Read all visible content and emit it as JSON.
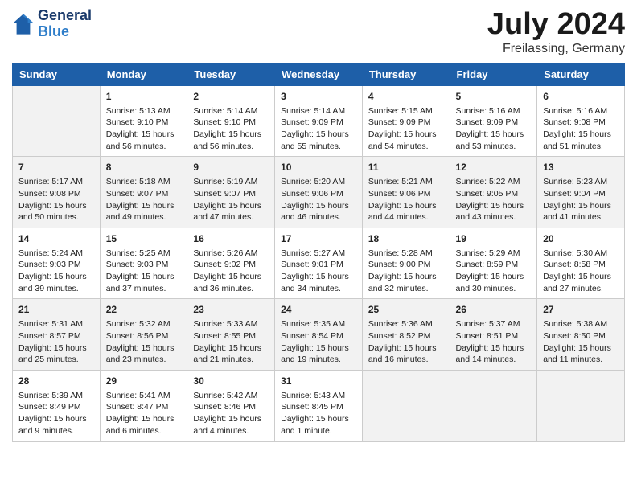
{
  "header": {
    "logo_line1": "General",
    "logo_line2": "Blue",
    "month": "July 2024",
    "location": "Freilassing, Germany"
  },
  "columns": [
    "Sunday",
    "Monday",
    "Tuesday",
    "Wednesday",
    "Thursday",
    "Friday",
    "Saturday"
  ],
  "weeks": [
    [
      {
        "day": "",
        "info": ""
      },
      {
        "day": "1",
        "info": "Sunrise: 5:13 AM\nSunset: 9:10 PM\nDaylight: 15 hours\nand 56 minutes."
      },
      {
        "day": "2",
        "info": "Sunrise: 5:14 AM\nSunset: 9:10 PM\nDaylight: 15 hours\nand 56 minutes."
      },
      {
        "day": "3",
        "info": "Sunrise: 5:14 AM\nSunset: 9:09 PM\nDaylight: 15 hours\nand 55 minutes."
      },
      {
        "day": "4",
        "info": "Sunrise: 5:15 AM\nSunset: 9:09 PM\nDaylight: 15 hours\nand 54 minutes."
      },
      {
        "day": "5",
        "info": "Sunrise: 5:16 AM\nSunset: 9:09 PM\nDaylight: 15 hours\nand 53 minutes."
      },
      {
        "day": "6",
        "info": "Sunrise: 5:16 AM\nSunset: 9:08 PM\nDaylight: 15 hours\nand 51 minutes."
      }
    ],
    [
      {
        "day": "7",
        "info": "Sunrise: 5:17 AM\nSunset: 9:08 PM\nDaylight: 15 hours\nand 50 minutes."
      },
      {
        "day": "8",
        "info": "Sunrise: 5:18 AM\nSunset: 9:07 PM\nDaylight: 15 hours\nand 49 minutes."
      },
      {
        "day": "9",
        "info": "Sunrise: 5:19 AM\nSunset: 9:07 PM\nDaylight: 15 hours\nand 47 minutes."
      },
      {
        "day": "10",
        "info": "Sunrise: 5:20 AM\nSunset: 9:06 PM\nDaylight: 15 hours\nand 46 minutes."
      },
      {
        "day": "11",
        "info": "Sunrise: 5:21 AM\nSunset: 9:06 PM\nDaylight: 15 hours\nand 44 minutes."
      },
      {
        "day": "12",
        "info": "Sunrise: 5:22 AM\nSunset: 9:05 PM\nDaylight: 15 hours\nand 43 minutes."
      },
      {
        "day": "13",
        "info": "Sunrise: 5:23 AM\nSunset: 9:04 PM\nDaylight: 15 hours\nand 41 minutes."
      }
    ],
    [
      {
        "day": "14",
        "info": "Sunrise: 5:24 AM\nSunset: 9:03 PM\nDaylight: 15 hours\nand 39 minutes."
      },
      {
        "day": "15",
        "info": "Sunrise: 5:25 AM\nSunset: 9:03 PM\nDaylight: 15 hours\nand 37 minutes."
      },
      {
        "day": "16",
        "info": "Sunrise: 5:26 AM\nSunset: 9:02 PM\nDaylight: 15 hours\nand 36 minutes."
      },
      {
        "day": "17",
        "info": "Sunrise: 5:27 AM\nSunset: 9:01 PM\nDaylight: 15 hours\nand 34 minutes."
      },
      {
        "day": "18",
        "info": "Sunrise: 5:28 AM\nSunset: 9:00 PM\nDaylight: 15 hours\nand 32 minutes."
      },
      {
        "day": "19",
        "info": "Sunrise: 5:29 AM\nSunset: 8:59 PM\nDaylight: 15 hours\nand 30 minutes."
      },
      {
        "day": "20",
        "info": "Sunrise: 5:30 AM\nSunset: 8:58 PM\nDaylight: 15 hours\nand 27 minutes."
      }
    ],
    [
      {
        "day": "21",
        "info": "Sunrise: 5:31 AM\nSunset: 8:57 PM\nDaylight: 15 hours\nand 25 minutes."
      },
      {
        "day": "22",
        "info": "Sunrise: 5:32 AM\nSunset: 8:56 PM\nDaylight: 15 hours\nand 23 minutes."
      },
      {
        "day": "23",
        "info": "Sunrise: 5:33 AM\nSunset: 8:55 PM\nDaylight: 15 hours\nand 21 minutes."
      },
      {
        "day": "24",
        "info": "Sunrise: 5:35 AM\nSunset: 8:54 PM\nDaylight: 15 hours\nand 19 minutes."
      },
      {
        "day": "25",
        "info": "Sunrise: 5:36 AM\nSunset: 8:52 PM\nDaylight: 15 hours\nand 16 minutes."
      },
      {
        "day": "26",
        "info": "Sunrise: 5:37 AM\nSunset: 8:51 PM\nDaylight: 15 hours\nand 14 minutes."
      },
      {
        "day": "27",
        "info": "Sunrise: 5:38 AM\nSunset: 8:50 PM\nDaylight: 15 hours\nand 11 minutes."
      }
    ],
    [
      {
        "day": "28",
        "info": "Sunrise: 5:39 AM\nSunset: 8:49 PM\nDaylight: 15 hours\nand 9 minutes."
      },
      {
        "day": "29",
        "info": "Sunrise: 5:41 AM\nSunset: 8:47 PM\nDaylight: 15 hours\nand 6 minutes."
      },
      {
        "day": "30",
        "info": "Sunrise: 5:42 AM\nSunset: 8:46 PM\nDaylight: 15 hours\nand 4 minutes."
      },
      {
        "day": "31",
        "info": "Sunrise: 5:43 AM\nSunset: 8:45 PM\nDaylight: 15 hours\nand 1 minute."
      },
      {
        "day": "",
        "info": ""
      },
      {
        "day": "",
        "info": ""
      },
      {
        "day": "",
        "info": ""
      }
    ]
  ]
}
